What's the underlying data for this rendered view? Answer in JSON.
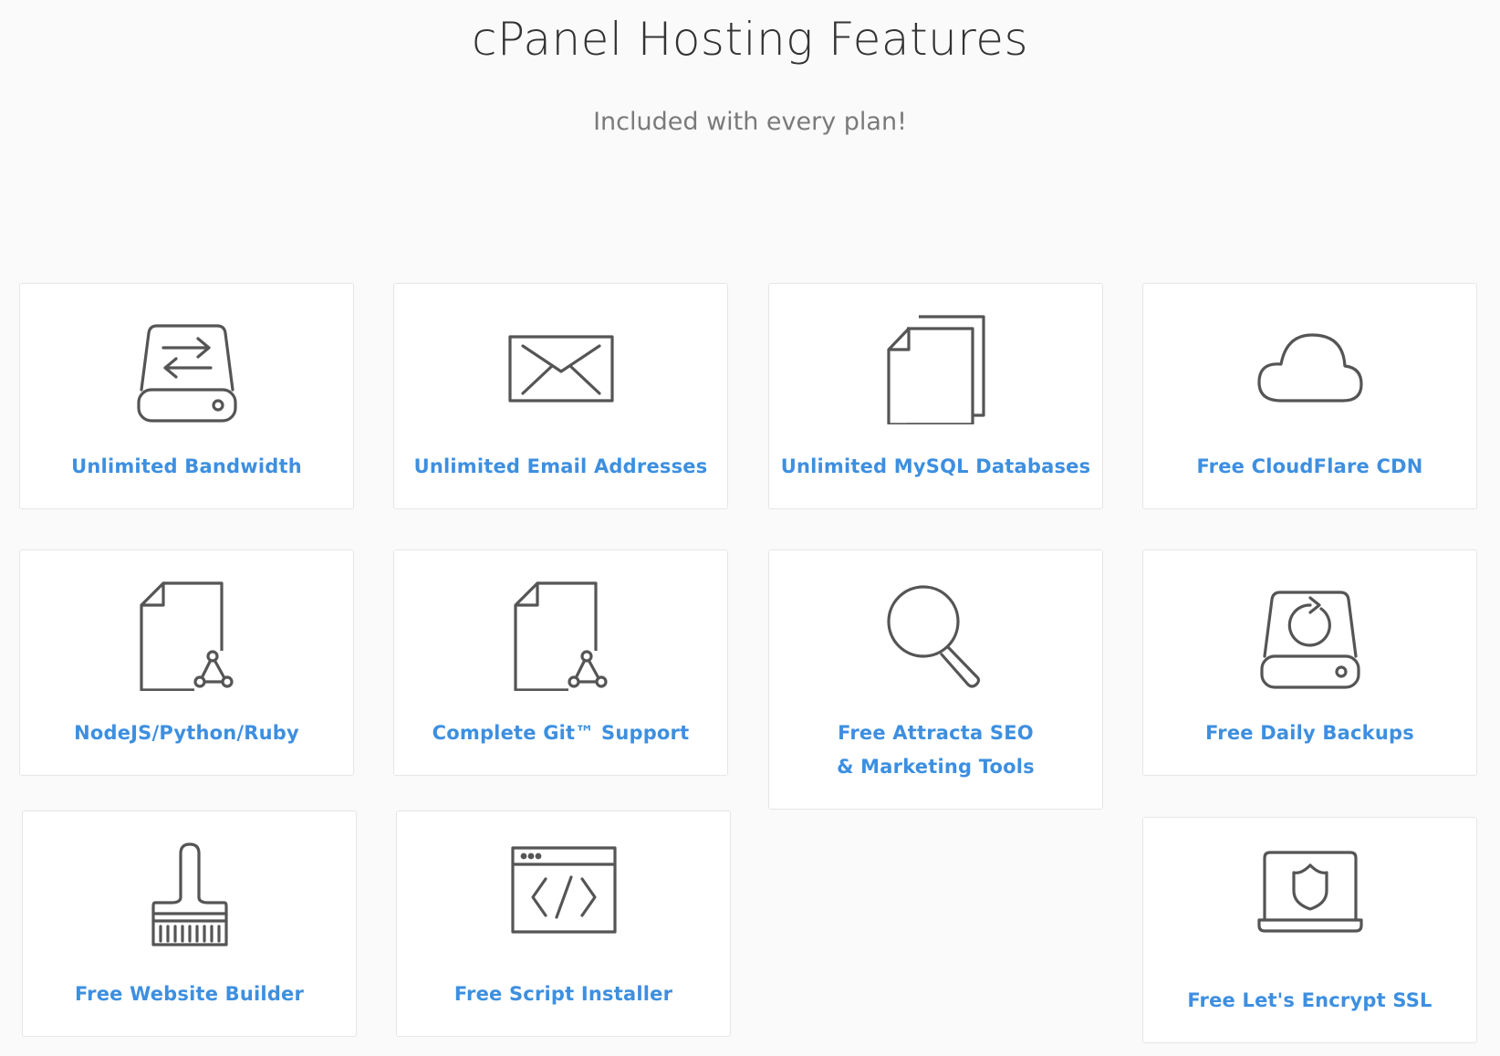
{
  "header": {
    "title": "cPanel Hosting Features",
    "subtitle": "Included with every plan!"
  },
  "colors": {
    "accent": "#3d8fe0",
    "icon_stroke": "#555555",
    "card_border": "#e6e6e6",
    "background": "#fafafa"
  },
  "features": [
    {
      "label": "Unlimited Bandwidth",
      "icon": "drive-transfer-icon"
    },
    {
      "label": "Unlimited Email Addresses",
      "icon": "envelope-icon"
    },
    {
      "label": "Unlimited MySQL Databases",
      "icon": "documents-icon"
    },
    {
      "label": "Free CloudFlare CDN",
      "icon": "cloud-icon"
    },
    {
      "label": "NodeJS/Python/Ruby",
      "icon": "file-network-icon"
    },
    {
      "label": "Complete Git™ Support",
      "icon": "git-file-icon"
    },
    {
      "label": "Free Attracta SEO & Marketing Tools",
      "icon": "magnifier-icon"
    },
    {
      "label": "Free Daily Backups",
      "icon": "drive-backup-icon"
    },
    {
      "label": "Free Website Builder",
      "icon": "paintbrush-icon"
    },
    {
      "label": "Free Script Installer",
      "icon": "code-window-icon"
    },
    {
      "label": "Free Let's Encrypt SSL",
      "icon": "laptop-shield-icon"
    }
  ]
}
